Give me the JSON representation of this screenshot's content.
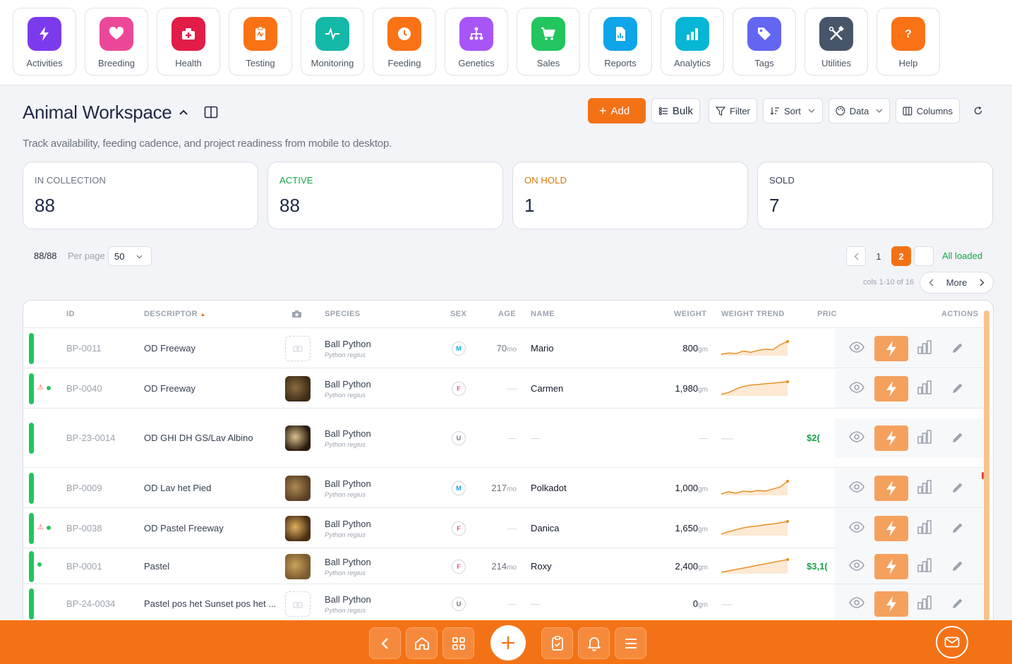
{
  "nav": [
    {
      "label": "Activities",
      "icon": "bolt-icon",
      "color": "#7c3aed"
    },
    {
      "label": "Breeding",
      "icon": "heart-icon",
      "color": "#ec4899"
    },
    {
      "label": "Health",
      "icon": "medkit-icon",
      "color": "#e11d48"
    },
    {
      "label": "Testing",
      "icon": "clipboard-icon",
      "color": "#f97316"
    },
    {
      "label": "Monitoring",
      "icon": "pulse-icon",
      "color": "#14b8a6"
    },
    {
      "label": "Feeding",
      "icon": "clock-icon",
      "color": "#f97316"
    },
    {
      "label": "Genetics",
      "icon": "hierarchy-icon",
      "color": "#a855f7"
    },
    {
      "label": "Sales",
      "icon": "cart-icon",
      "color": "#22c55e"
    },
    {
      "label": "Reports",
      "icon": "report-icon",
      "color": "#0ea5e9"
    },
    {
      "label": "Analytics",
      "icon": "bar-chart-icon",
      "color": "#06b6d4"
    },
    {
      "label": "Tags",
      "icon": "tag-icon",
      "color": "#6366f1"
    },
    {
      "label": "Utilities",
      "icon": "tools-icon",
      "color": "#475569"
    },
    {
      "label": "Help",
      "icon": "question-icon",
      "color": "#f97316"
    }
  ],
  "header": {
    "title": "Animal Workspace",
    "subtitle": "Track availability, feeding cadence, and project readiness from mobile to desktop."
  },
  "toolbar": {
    "add": "Add",
    "bulk": "Bulk",
    "filter": "Filter",
    "sort": "Sort",
    "data": "Data",
    "columns": "Columns"
  },
  "stats": [
    {
      "label": "IN COLLECTION",
      "value": "88",
      "color": "#6b7280"
    },
    {
      "label": "ACTIVE",
      "value": "88",
      "color": "#16a34a"
    },
    {
      "label": "ON HOLD",
      "value": "1",
      "color": "#d97706"
    },
    {
      "label": "SOLD",
      "value": "7",
      "color": "#374151"
    }
  ],
  "pager": {
    "count": "88/88",
    "per_page_label": "Per page",
    "per_page": "50",
    "page1": "1",
    "page2": "2",
    "status": "All loaded",
    "cols_info": "cols 1-10 of 16",
    "more": "More"
  },
  "columns": {
    "id": "ID",
    "descriptor": "DESCRIPTOR",
    "species": "SPECIES",
    "sex": "SEX",
    "age": "AGE",
    "name": "NAME",
    "weight": "WEIGHT",
    "trend": "WEIGHT TREND",
    "price": "PRIC",
    "actions": "ACTIONS"
  },
  "rows": [
    {
      "id": "BP-0011",
      "descriptor": "OD Freeway",
      "species": "Ball Python",
      "latin": "Python regius",
      "sex": "M",
      "age": "70",
      "age_unit": "mo",
      "name": "Mario",
      "weight": "800",
      "weight_unit": "gm",
      "price": "",
      "trend": [
        30,
        32,
        31,
        35,
        33,
        36,
        38,
        37,
        45,
        50
      ],
      "photo": false,
      "warn": false,
      "dot": false
    },
    {
      "id": "BP-0040",
      "descriptor": "OD Freeway",
      "species": "Ball Python",
      "latin": "Python regius",
      "sex": "F",
      "age": "—",
      "age_unit": "",
      "name": "Carmen",
      "weight": "1,980",
      "weight_unit": "gm",
      "price": "",
      "trend": [
        30,
        33,
        38,
        42,
        44,
        45,
        46,
        47,
        48,
        49
      ],
      "photo": true,
      "warn": true,
      "dot": true
    },
    {
      "id": "BP-23-0014",
      "descriptor": "OD GHI DH GS/Lav Albino",
      "species": "Ball Python",
      "latin": "Python regius",
      "sex": "U",
      "age": "—",
      "age_unit": "",
      "name": "—",
      "weight": "—",
      "weight_unit": "",
      "price": "$2(",
      "trend": [],
      "photo": true,
      "warn": false,
      "dot": false
    },
    {
      "id": "BP-0009",
      "descriptor": "OD Lav het Pied",
      "species": "Ball Python",
      "latin": "Python regius",
      "sex": "M",
      "age": "217",
      "age_unit": "mo",
      "name": "Polkadot",
      "weight": "1,000",
      "weight_unit": "gm",
      "price": "",
      "trend": [
        30,
        33,
        31,
        34,
        33,
        35,
        34,
        37,
        40,
        48
      ],
      "photo": true,
      "warn": false,
      "dot": false
    },
    {
      "id": "BP-0038",
      "descriptor": "OD Pastel Freeway",
      "species": "Ball Python",
      "latin": "Python regius",
      "sex": "F",
      "age": "—",
      "age_unit": "",
      "name": "Danica",
      "weight": "1,650",
      "weight_unit": "gm",
      "price": "",
      "trend": [
        30,
        34,
        37,
        40,
        42,
        43,
        45,
        46,
        48,
        50
      ],
      "photo": true,
      "warn": true,
      "dot": true
    },
    {
      "id": "BP-0001",
      "descriptor": "Pastel",
      "species": "Ball Python",
      "latin": "Python regius",
      "sex": "F",
      "age": "214",
      "age_unit": "mo",
      "name": "Roxy",
      "weight": "2,400",
      "weight_unit": "gm",
      "price": "$3,1(",
      "trend": [
        30,
        33,
        36,
        39,
        42,
        45,
        48,
        51
      ],
      "photo": true,
      "warn": false,
      "dot": true
    },
    {
      "id": "BP-24-0034",
      "descriptor": "Pastel pos het Sunset pos het ...",
      "species": "Ball Python",
      "latin": "Python regius",
      "sex": "U",
      "age": "—",
      "age_unit": "",
      "name": "—",
      "weight": "0",
      "weight_unit": "gm",
      "price": "",
      "trend": [],
      "photo": false,
      "warn": false,
      "dot": false
    }
  ]
}
